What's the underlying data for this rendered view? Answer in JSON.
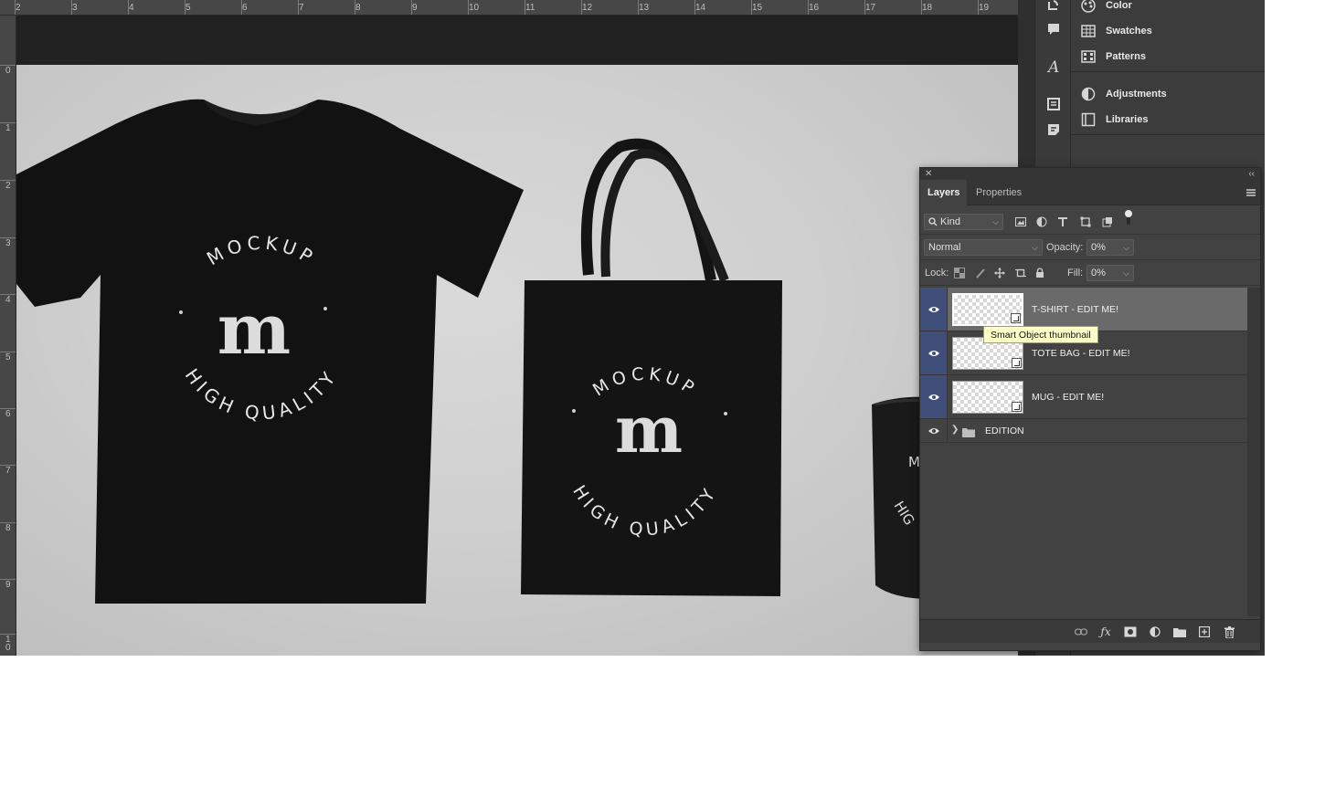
{
  "rulers": {
    "horizontal": [
      "2",
      "3",
      "4",
      "5",
      "6",
      "7",
      "8",
      "9",
      "10",
      "11",
      "12",
      "13",
      "14",
      "15",
      "16",
      "17",
      "18",
      "19"
    ],
    "vertical": [
      "0",
      "1",
      "2",
      "3",
      "4",
      "5",
      "6",
      "7",
      "8",
      "9",
      "1\n0"
    ]
  },
  "canvas": {
    "tshirt": {
      "top_text": "MOCKUP",
      "letter": "m",
      "bottom_text": "HIGH QUALITY"
    },
    "tote": {
      "top_text": "MOCKUP",
      "letter": "m",
      "bottom_text": "HIGH QUALITY"
    },
    "mug": {
      "partial_text_1": "M",
      "partial_text_2": "HIG"
    }
  },
  "panel_list": {
    "items": [
      {
        "label": "Color",
        "icon": "color-palette-icon"
      },
      {
        "label": "Swatches",
        "icon": "swatches-grid-icon"
      },
      {
        "label": "Patterns",
        "icon": "patterns-grid-icon"
      },
      {
        "label": "Adjustments",
        "icon": "adjustments-circle-icon"
      },
      {
        "label": "Libraries",
        "icon": "libraries-icon"
      }
    ]
  },
  "layers_panel": {
    "tabs": [
      "Layers",
      "Properties"
    ],
    "filter_kind": "Kind",
    "blend_mode": "Normal",
    "opacity_label": "Opacity:",
    "opacity_value": "0%",
    "lock_label": "Lock:",
    "fill_label": "Fill:",
    "fill_value": "0%",
    "layers": [
      {
        "name": "T-SHIRT - EDIT ME!",
        "selected": true
      },
      {
        "name": "TOTE BAG - EDIT ME!",
        "selected": false
      },
      {
        "name": "MUG - EDIT ME!",
        "selected": false
      }
    ],
    "group": {
      "name": "EDITION"
    },
    "tooltip": "Smart Object thumbnail"
  },
  "colors": {
    "selection_eye": "#3f4f7a",
    "panel_bg": "#424242",
    "tooltip_bg": "#ffffc8"
  }
}
